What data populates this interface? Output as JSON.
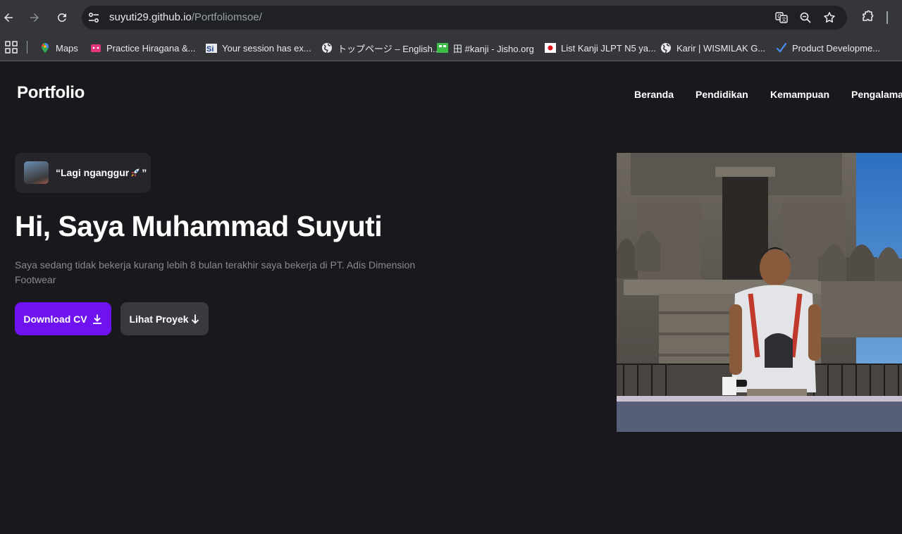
{
  "browser": {
    "url_host": "suyuti29.github.io",
    "url_path": "/Portfoliomsoe/",
    "bookmarks": [
      {
        "label": "Maps",
        "icon": "maps-pin-icon"
      },
      {
        "label": "Practice Hiragana &...",
        "icon": "pink-controller-icon"
      },
      {
        "label": "Your session has ex...",
        "icon": "si-logo-icon"
      },
      {
        "label": "トップページ – English...",
        "icon": "globe-icon"
      },
      {
        "label": "田 #kanji - Jisho.org",
        "icon": "jisho-icon"
      },
      {
        "label": "List Kanji JLPT N5 ya...",
        "icon": "japan-flag-icon"
      },
      {
        "label": "Karir | WISMILAK G...",
        "icon": "globe-icon"
      },
      {
        "label": "Product Developme...",
        "icon": "blue-check-icon"
      }
    ]
  },
  "site": {
    "logo": "Portfolio",
    "nav": [
      "Beranda",
      "Pendidikan",
      "Kemampuan",
      "Pengalaman"
    ]
  },
  "hero": {
    "status_open": "“Lagi nganggur",
    "status_close": "”",
    "title": "Hi, Saya Muhammad Suyuti",
    "description": "Saya sedang tidak bekerja kurang lebih 8 bulan terakhir saya bekerja di PT. Adis Dimension Footwear",
    "download_label": "Download CV",
    "projects_label": "Lihat Proyek"
  },
  "colors": {
    "background": "#19181d",
    "primary_button": "#6e12f0",
    "secondary_button": "#3a393f",
    "chip": "#26252b"
  }
}
